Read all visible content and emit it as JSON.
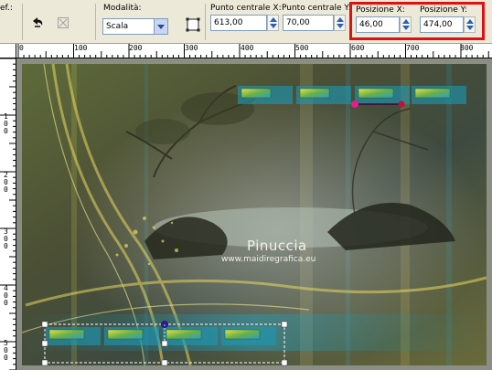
{
  "toolbar": {
    "ef_label": "ef.:",
    "modalita_label": "Modalità:",
    "modalita_value": "Scala",
    "punto_x_label": "Punto centrale X:",
    "punto_x_value": "613,00",
    "punto_y_label": "Punto centrale Y:",
    "punto_y_value": "70,00",
    "pos_x_label": "Posizione X:",
    "pos_x_value": "46,00",
    "pos_y_label": "Posizione Y:",
    "pos_y_value": "474,00",
    "highlight_color": "#e01010"
  },
  "ruler": {
    "top_ticks": [
      "0",
      "100",
      "200",
      "300",
      "400",
      "500",
      "600",
      "700",
      "800"
    ],
    "left_ticks": [
      "1\n0\n0",
      "2\n0\n0",
      "3\n0\n0",
      "4\n0\n0",
      "5\n0\n0"
    ]
  },
  "canvas": {
    "watermark_title": "Pinuccia",
    "watermark_url": "www.maidiregrafica.eu"
  }
}
